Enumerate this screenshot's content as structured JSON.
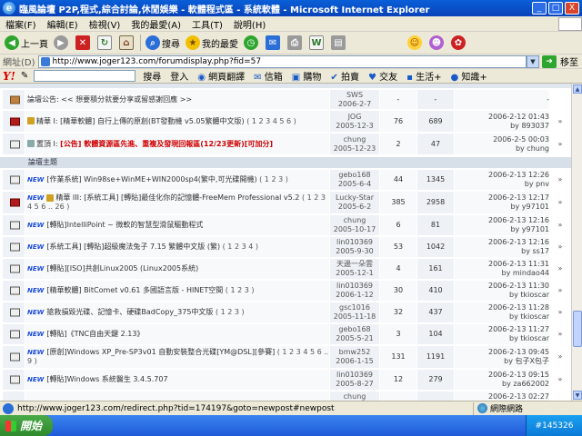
{
  "window": {
    "title": "臨風論壇 P2P,程式,綜合討論,休閒娛樂 - 軟體程式區 - 系統軟體 - Microsoft Internet Explorer",
    "minimize": "_",
    "maximize": "□",
    "close": "X"
  },
  "menu": [
    "檔案(F)",
    "編輯(E)",
    "檢視(V)",
    "我的最愛(A)",
    "工具(T)",
    "說明(H)"
  ],
  "toolbar": {
    "back": "上一頁",
    "search": "搜尋",
    "favorites": "我的最愛"
  },
  "address": {
    "label": "網址(D)",
    "url": "http://www.joger123.com/forumdisplay.php?fid=57",
    "go": "移至"
  },
  "yahoo": {
    "logo": "Y!",
    "search_btn": "搜尋",
    "login": "登入",
    "items": [
      "網頁翻譯",
      "信箱",
      "購物",
      "拍賣",
      "交友",
      "生活+",
      "知識+"
    ]
  },
  "announcements": [
    {
      "icon": "pin",
      "title": "論壇公告: << 想要積分就要分享或留感謝回應 >>",
      "author": "SWS",
      "date": "2006-2-7",
      "replies": "-",
      "views": "-",
      "last": "-",
      "last_by": ""
    },
    {
      "icon": "hot",
      "prefix": "精華 I:",
      "title": "[精華軟體] 自行上傳的原創(BT發動機 v5.05繁體中文版)",
      "pages": "( 1 2 3 4 5 6 )",
      "author": "JOG",
      "date": "2005-12-3",
      "replies": "76",
      "views": "689",
      "last": "2006-2-12 01:43",
      "last_by": "by 893037"
    },
    {
      "icon": "normal",
      "prefix": "置頂 I:",
      "title": "[公告] 軟體資源區先進、重複及發現回報區(12/23更新)[可加分]",
      "author": "chung",
      "date": "2005-12-23",
      "replies": "2",
      "views": "47",
      "last": "2006-2-5 00:03",
      "last_by": "by chung"
    }
  ],
  "section_title": "論壇主題",
  "threads": [
    {
      "icon": "normal",
      "new": "NEW",
      "title": "[作業系統] Win98se+WinME+WIN2000sp4(繁中,可光碟開機)",
      "pages": "( 1 2 3 )",
      "author": "gebo168",
      "date": "2005-6-4",
      "replies": "44",
      "views": "1345",
      "last": "2006-2-13 12:26",
      "last_by": "by pnv"
    },
    {
      "icon": "hot",
      "new": "NEW",
      "prefix": "精華 III:",
      "title": "[系統工具] [轉貼]最佳化你的記憶體-FreeMem Professional v5.2",
      "pages": "( 1 2 3 4 5 6 .. 26 )",
      "author": "Lucky-Star",
      "date": "2005-6-2",
      "replies": "385",
      "views": "2958",
      "last": "2006-2-13 12:17",
      "last_by": "by y97101"
    },
    {
      "icon": "normal",
      "new": "NEW",
      "title": "[轉貼]IntelliPoint ~ 微軟的智慧型滑鼠驅動程式",
      "author": "chung",
      "date": "2005-10-17",
      "replies": "6",
      "views": "81",
      "last": "2006-2-13 12:16",
      "last_by": "by y97101"
    },
    {
      "icon": "normal",
      "new": "NEW",
      "title": "[系統工具] [轉貼]超級魔法兔子 7.15 繁體中文版 (繁)",
      "pages": "( 1 2 3 4 )",
      "author": "lin010369",
      "date": "2005-9-30",
      "replies": "53",
      "views": "1042",
      "last": "2006-2-13 12:16",
      "last_by": "by ss17"
    },
    {
      "icon": "normal",
      "new": "NEW",
      "title": "[轉貼][ISO]共創Linux2005 (Linux2005系統)",
      "author": "天邊一朵雲",
      "date": "2005-12-1",
      "replies": "4",
      "views": "161",
      "last": "2006-2-13 11:31",
      "last_by": "by mindao44"
    },
    {
      "icon": "normal",
      "new": "NEW",
      "title": "[精華軟體] BitComet v0.61 多國語言版 - HINET空間",
      "pages": "( 1 2 3 )",
      "author": "lin010369",
      "date": "2006-1-12",
      "replies": "30",
      "views": "410",
      "last": "2006-2-13 11:30",
      "last_by": "by tkioscar"
    },
    {
      "icon": "normal",
      "new": "NEW",
      "title": "搶救損毀光碟、記憶卡、硬碟BadCopy_375中文版",
      "pages": "( 1 2 3 )",
      "author": "gsc1016",
      "date": "2005-11-18",
      "replies": "32",
      "views": "437",
      "last": "2006-2-13 11:28",
      "last_by": "by tkioscar"
    },
    {
      "icon": "normal",
      "new": "NEW",
      "title": "[轉貼]《TNC自由天鍵 2.13》",
      "author": "gebo168",
      "date": "2005-5-21",
      "replies": "3",
      "views": "104",
      "last": "2006-2-13 11:27",
      "last_by": "by tkioscar"
    },
    {
      "icon": "normal",
      "new": "NEW",
      "title": "[原創]Windows XP_Pre-SP3v01 自動安裝整合光碟[YM@DSL][參賽]",
      "pages": "( 1 2 3 4 5 6 .. 9 )",
      "author": "bmw252",
      "date": "2006-1-15",
      "replies": "131",
      "views": "1191",
      "last": "2006-2-13 09:45",
      "last_by": "by 包子X包子"
    },
    {
      "icon": "normal",
      "new": "NEW",
      "title": "[轉貼]Windows 系統醫生 3.4.5.707",
      "author": "lin010369",
      "date": "2005-8-27",
      "replies": "12",
      "views": "279",
      "last": "2006-2-13 09:15",
      "last_by": "by za662002"
    },
    {
      "icon": "normal",
      "new": "",
      "title": "",
      "author": "chung",
      "date": "",
      "replies": "",
      "views": "",
      "last": "2006-2-13 02:27",
      "last_by": ""
    }
  ],
  "status": {
    "text": "http://www.joger123.com/redirect.php?tid=174197&goto=newpost#newpost",
    "zone": "網際網路"
  },
  "taskbar": {
    "start": "開始",
    "tray": "#145326"
  }
}
